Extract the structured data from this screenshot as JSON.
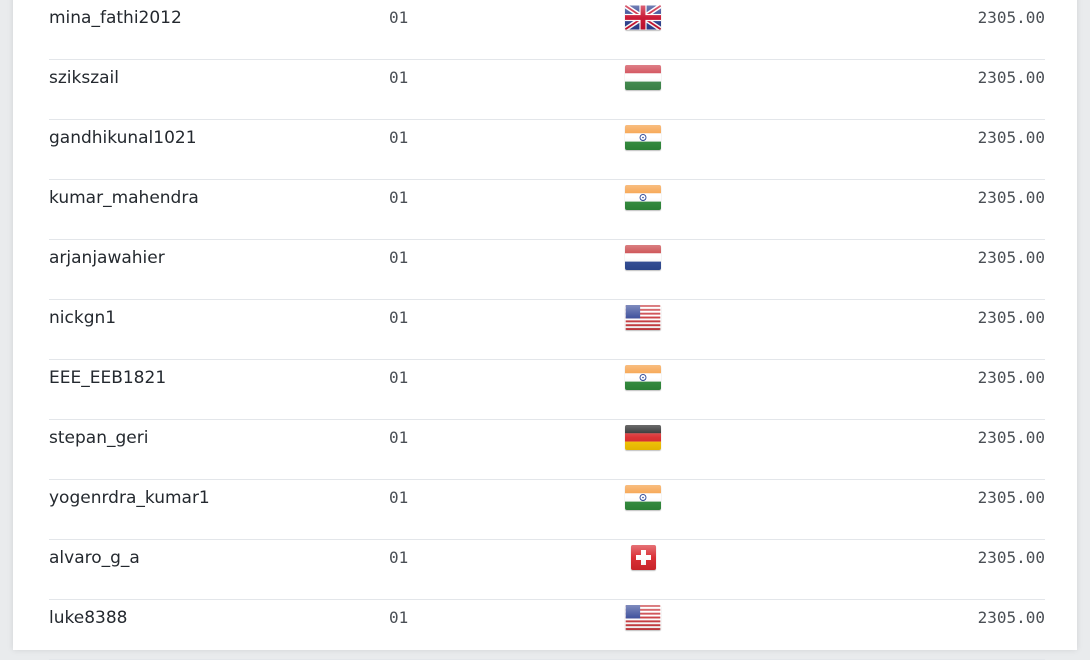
{
  "leaderboard": {
    "rows": [
      {
        "username": "mina_fathi2012",
        "rank": "01",
        "country": "gb-flag-icon",
        "amount": "2305.00"
      },
      {
        "username": "szikszail",
        "rank": "01",
        "country": "hu-flag-icon",
        "amount": "2305.00"
      },
      {
        "username": "gandhikunal1021",
        "rank": "01",
        "country": "in-flag-icon",
        "amount": "2305.00"
      },
      {
        "username": "kumar_mahendra",
        "rank": "01",
        "country": "in-flag-icon",
        "amount": "2305.00"
      },
      {
        "username": "arjanjawahier",
        "rank": "01",
        "country": "nl-flag-icon",
        "amount": "2305.00"
      },
      {
        "username": "nickgn1",
        "rank": "01",
        "country": "us-flag-icon",
        "amount": "2305.00"
      },
      {
        "username": "EEE_EEB1821",
        "rank": "01",
        "country": "in-flag-icon",
        "amount": "2305.00"
      },
      {
        "username": "stepan_geri",
        "rank": "01",
        "country": "de-flag-icon",
        "amount": "2305.00"
      },
      {
        "username": "yogenrdra_kumar1",
        "rank": "01",
        "country": "in-flag-icon",
        "amount": "2305.00"
      },
      {
        "username": "alvaro_g_a",
        "rank": "01",
        "country": "ch-flag-icon",
        "amount": "2305.00"
      },
      {
        "username": "luke8388",
        "rank": "01",
        "country": "us-flag-icon",
        "amount": "2305.00"
      }
    ]
  },
  "colors": {
    "text": "#24292f",
    "muted": "#4a4f55",
    "divider": "#e3e6ea",
    "background": "#e9ebed",
    "card": "#ffffff"
  }
}
